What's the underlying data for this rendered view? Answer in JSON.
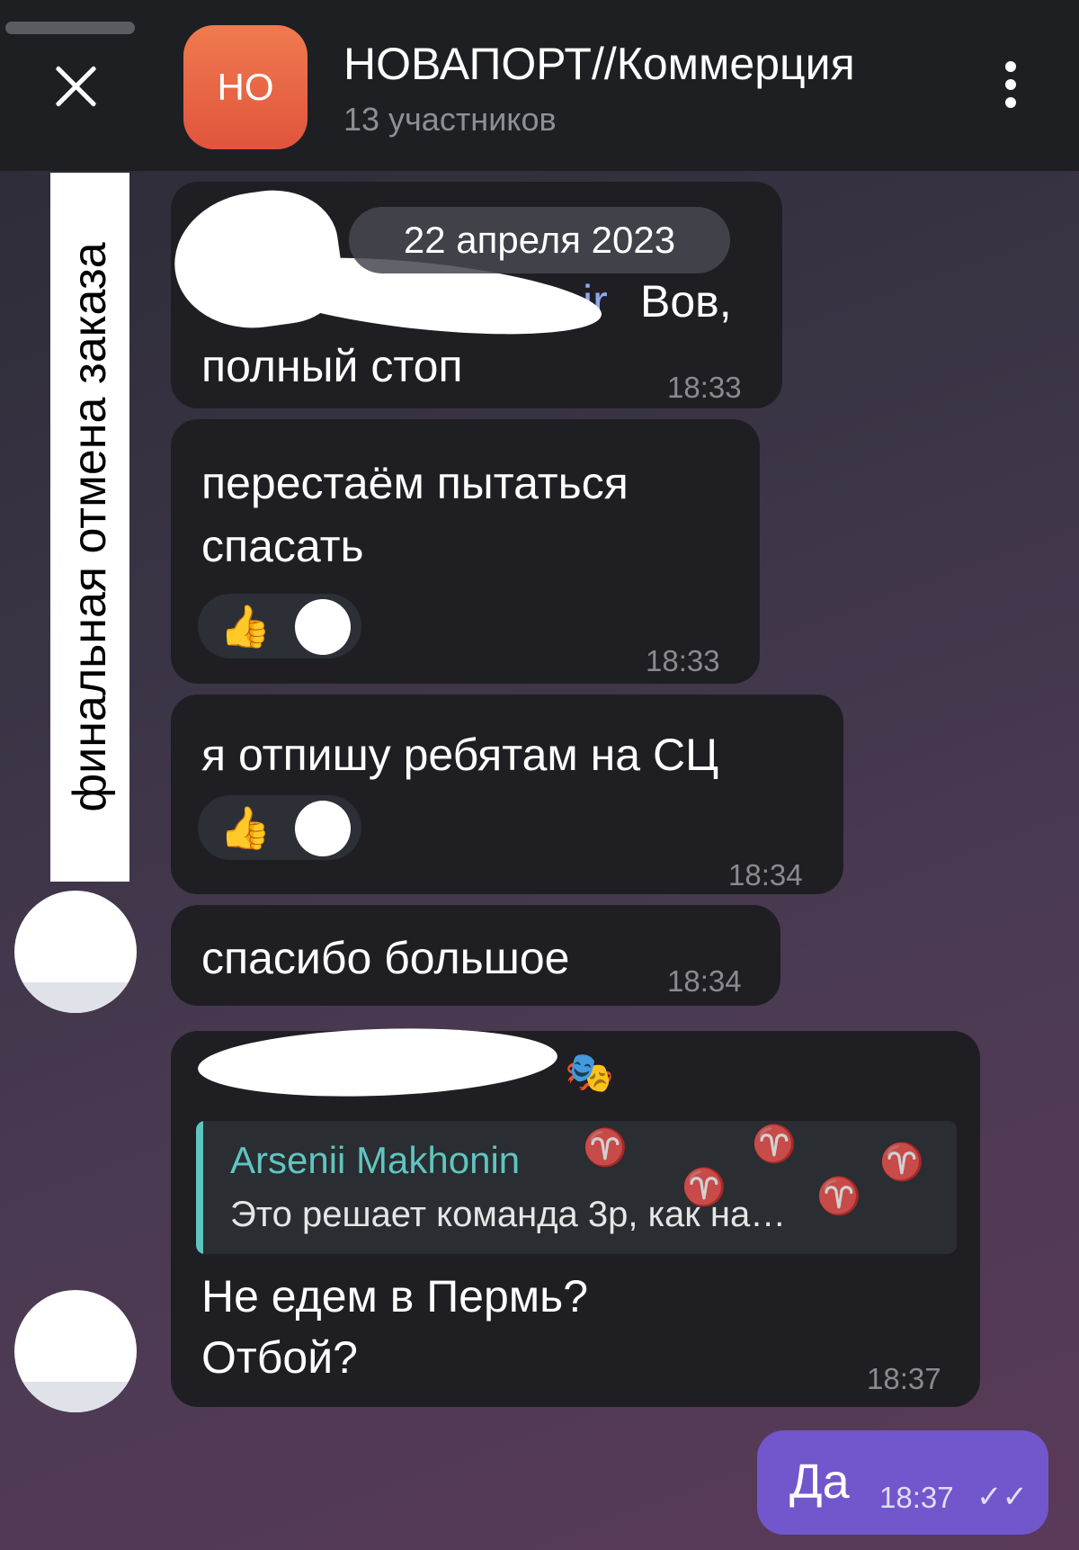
{
  "header": {
    "avatar_initials": "НО",
    "title": "НОВАПОРТ//Коммерция",
    "subtitle": "13 участников"
  },
  "overlay_label": "финальная отмена заказа",
  "date_divider": "22 апреля 2023",
  "messages": [
    {
      "text_tail": "Вов,",
      "text_line2": "полный стоп",
      "time": "18:33",
      "mention_visible": "ir"
    },
    {
      "text_line1": "перестаём пытаться",
      "text_line2": "спасать",
      "time": "18:33",
      "reaction": "👍"
    },
    {
      "text": "я отпишу ребятам на СЦ",
      "time": "18:34",
      "reaction": "👍"
    },
    {
      "text": "спасибо большое",
      "time": "18:34"
    },
    {
      "reply_name": "Arsenii Makhonin",
      "reply_text": "Это решает команда 3р, как на…",
      "text_line1": "Не едем в Пермь?",
      "text_line2": "Отбой?",
      "time": "18:37"
    }
  ],
  "outgoing": {
    "text": "Да",
    "time": "18:37",
    "status": "✓✓"
  },
  "colors": {
    "accent": "#7256cc",
    "reply": "#5fc5c0",
    "bubble": "#1f1f23"
  }
}
